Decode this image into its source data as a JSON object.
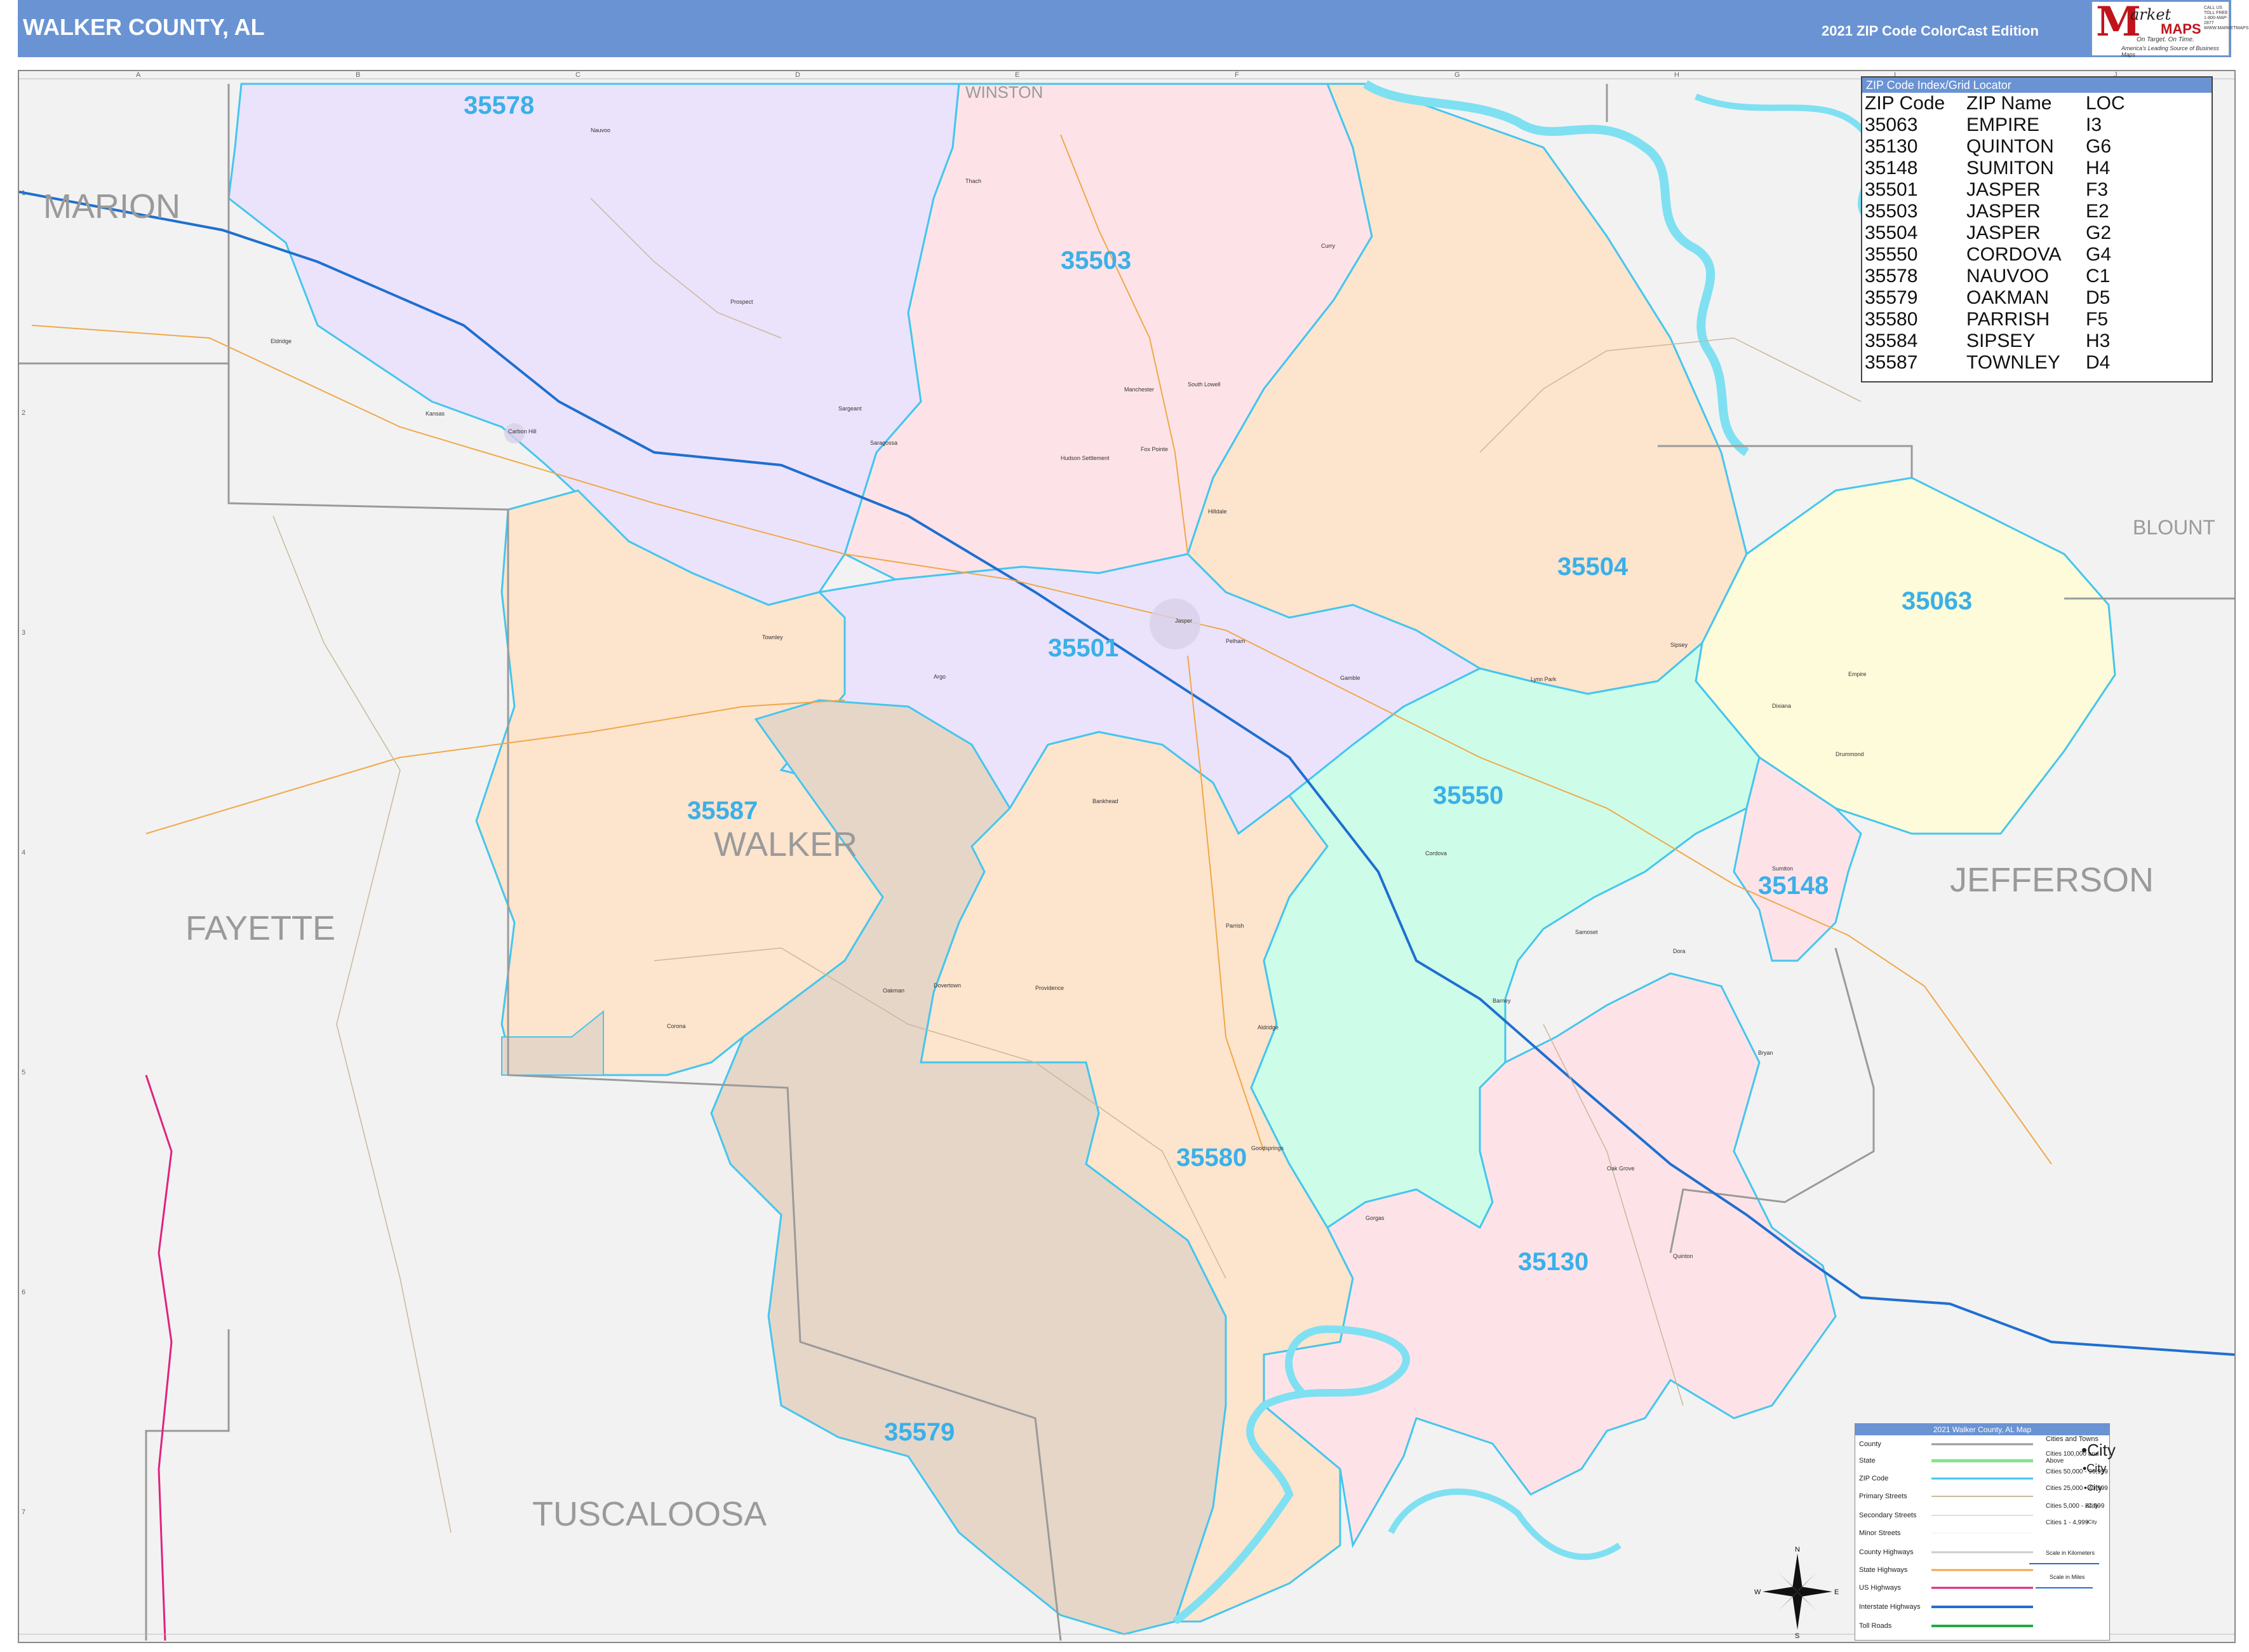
{
  "header": {
    "title": "WALKER COUNTY, AL",
    "edition": "2021 ZIP Code ColorCast Edition",
    "logo_text": "Market MAPS",
    "logo_market": "M",
    "logo_arket": "arket",
    "logo_maps": "MAPS",
    "logo_tagline": "On Target. On Time.",
    "logo_sub": "America's Leading Source of Business Maps",
    "logo_contact": "CALL US TOLL FREE 1-800-MAP-2877 WWW.MARKETMAPS.COM"
  },
  "colors": {
    "header": "#6a93d4",
    "zip_label": "#3ab0e8",
    "zip_border": "#44c6ee",
    "county_label": "#9a9a9a",
    "zones": {
      "35578": "#ebe3fb",
      "35503": "#fde3e8",
      "35504": "#fde4cd",
      "35501": "#ebe3fb",
      "35587": "#fde4cd",
      "35550": "#cdfde8",
      "35063": "#fdfbd9",
      "35148": "#fde3e8",
      "35580": "#fde4cd",
      "35130": "#fde3e8",
      "35579": "#e6d6c8"
    }
  },
  "map": {
    "counties": [
      "MARION",
      "FAYETTE",
      "WALKER",
      "TUSCALOOSA",
      "JEFFERSON",
      "BLOUNT",
      "WINSTON"
    ],
    "zip_labels": [
      "35578",
      "35503",
      "35504",
      "35063",
      "35501",
      "35587",
      "35550",
      "35148",
      "35580",
      "35130",
      "35579"
    ],
    "towns": [
      "Nauvoo",
      "Thach",
      "Curry",
      "Eldridge",
      "Prospect",
      "Kansas",
      "Carbon Hill",
      "Sargeant",
      "Manchester",
      "South Lowell",
      "Hudson Settlement",
      "Fox Pointe",
      "Hilldale",
      "Jasper",
      "Saragossa",
      "Townley",
      "Pelham",
      "Argo",
      "Sumiton",
      "Cordova",
      "Parrish",
      "Oakman",
      "Dora",
      "Quinton",
      "Empire",
      "Sipsey",
      "Goodsprings",
      "Gorgas",
      "Barney",
      "Dovertown",
      "Bryan",
      "Oak Grove",
      "Lynn Park",
      "Gamble",
      "Samoset",
      "Bankhead",
      "Providence",
      "Aldridge",
      "Dixiana",
      "Drummond",
      "Corona"
    ],
    "grid_cols": [
      "A",
      "B",
      "C",
      "D",
      "E",
      "F",
      "G",
      "H",
      "I",
      "J"
    ],
    "grid_rows": [
      "1",
      "2",
      "3",
      "4",
      "5",
      "6",
      "7"
    ]
  },
  "index": {
    "title": "ZIP Code Index/Grid Locator",
    "headers": [
      "ZIP Code",
      "ZIP Name",
      "LOC"
    ],
    "rows": [
      [
        "35063",
        "EMPIRE",
        "I3"
      ],
      [
        "35130",
        "QUINTON",
        "G6"
      ],
      [
        "35148",
        "SUMITON",
        "H4"
      ],
      [
        "35501",
        "JASPER",
        "F3"
      ],
      [
        "35503",
        "JASPER",
        "E2"
      ],
      [
        "35504",
        "JASPER",
        "G2"
      ],
      [
        "35550",
        "CORDOVA",
        "G4"
      ],
      [
        "35578",
        "NAUVOO",
        "C1"
      ],
      [
        "35579",
        "OAKMAN",
        "D5"
      ],
      [
        "35580",
        "PARRISH",
        "F5"
      ],
      [
        "35584",
        "SIPSEY",
        "H3"
      ],
      [
        "35587",
        "TOWNLEY",
        "D4"
      ]
    ]
  },
  "legend": {
    "title": "2021 Walker County, AL Map",
    "items": [
      "County",
      "State",
      "ZIP Code",
      "Primary Streets",
      "Secondary Streets",
      "Minor Streets",
      "County Highways",
      "State Highways",
      "US Highways",
      "Interstate Highways",
      "Toll Roads"
    ],
    "cities_title": "Cities and Towns",
    "cities": [
      "Cities 100,000 and Above",
      "Cities 50,000 - 99,999",
      "Cities 25,000 - 49,999",
      "Cities 5,000 - 24,999",
      "Cities 1 - 4,999"
    ],
    "city_samples": [
      "•City",
      "•City",
      "•City",
      "•City",
      "•City"
    ],
    "scale_km": "Scale in Kilometers",
    "scale_mi": "Scale in Miles"
  },
  "compass": [
    "N",
    "S",
    "E",
    "W"
  ]
}
